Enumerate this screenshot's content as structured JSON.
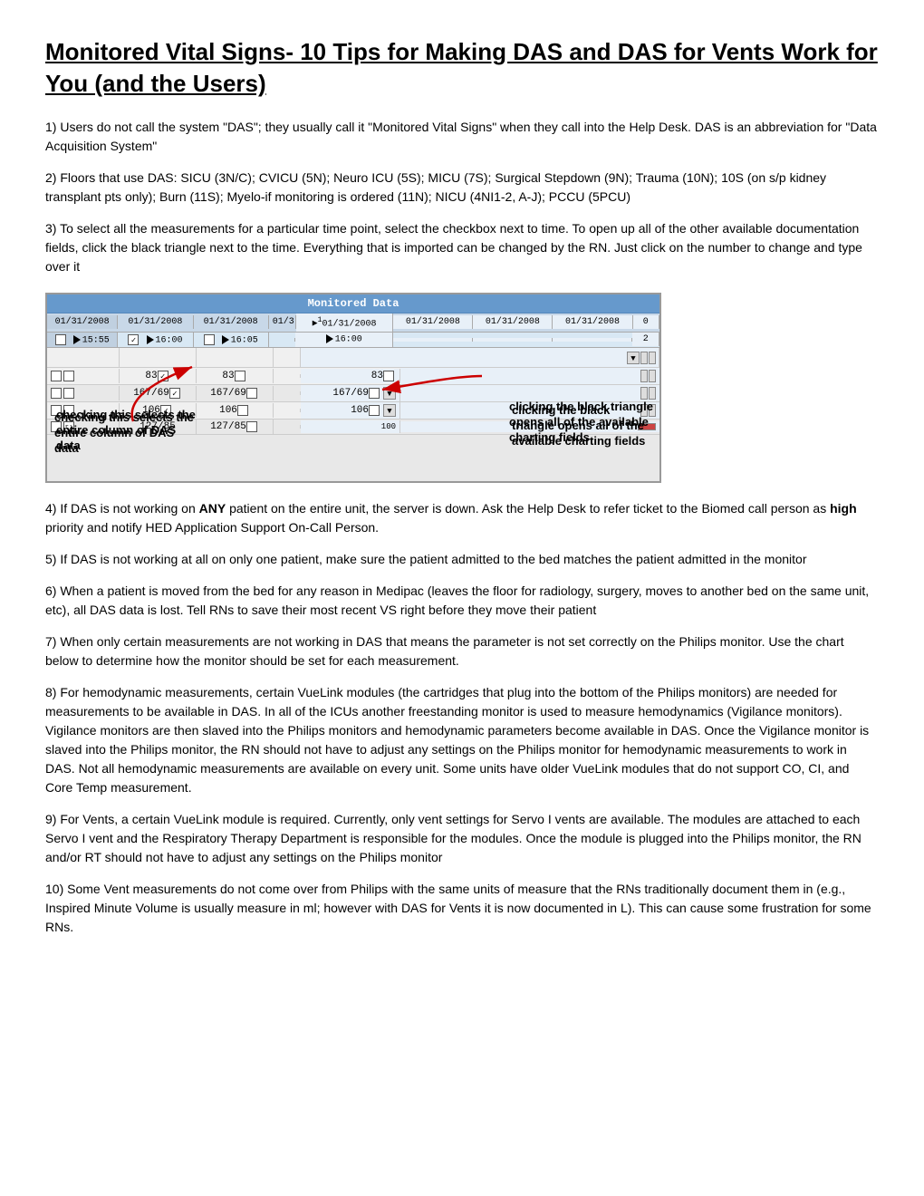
{
  "title": "Monitored Vital Signs- 10 Tips for Making DAS and DAS for Vents Work for You (and the Users)",
  "paragraphs": [
    {
      "id": "p1",
      "text": "1) Users do not call the system \"DAS\"; they usually call it \"Monitored Vital Signs\" when they call into the Help Desk. DAS is an abbreviation for \"Data Acquisition System\""
    },
    {
      "id": "p2",
      "text": "2) Floors that use DAS: SICU (3N/C); CVICU (5N); Neuro ICU (5S); MICU (7S); Surgical Stepdown (9N); Trauma (10N); 10S (on s/p kidney transplant pts only); Burn (11S); Myelo-if monitoring is ordered (11N); NICU (4NI1-2, A-J); PCCU (5PCU)"
    },
    {
      "id": "p3",
      "text": "3) To select all the measurements for a particular time point, select the checkbox next to time. To open up all of the other available documentation fields, click the black triangle next to the time. Everything that is imported can be changed by the RN. Just click on the number to change and type over it"
    },
    {
      "id": "p4",
      "html": true,
      "text": "4) If DAS is not working on <b>ANY</b> patient on the entire unit, the server is down. Ask the Help Desk to refer ticket to the Biomed call person as <b>high</b> priority and notify HED Application Support On-Call Person."
    },
    {
      "id": "p5",
      "text": "5) If DAS is not working at all on only one patient, make sure the patient admitted to the bed matches the patient admitted in the monitor"
    },
    {
      "id": "p6",
      "text": "6) When a patient is moved from the bed for any reason in Medipac (leaves the floor for radiology, surgery, moves to another bed on the same unit, etc), all DAS data is lost. Tell RNs to save their most recent VS right before they move their patient"
    },
    {
      "id": "p7",
      "text": "7) When only certain measurements are not working in DAS that means the parameter is not set correctly on the Philips monitor. Use the chart below to determine how the monitor should be set for each measurement."
    },
    {
      "id": "p8",
      "text": "8) For hemodynamic measurements, certain VueLink modules (the cartridges that plug into the bottom of the Philips monitors) are needed for measurements to be available in DAS. In all of the ICUs another freestanding monitor is used to measure hemodynamics (Vigilance monitors). Vigilance monitors are then slaved into the Philips monitors and hemodynamic parameters become available in DAS. Once the Vigilance monitor is slaved into the Philips monitor, the RN should not have to adjust any settings on the Philips monitor for hemodynamic measurements to work in DAS. Not all hemodynamic measurements are available on every unit. Some units have older VueLink modules that do not support CO, CI, and Core Temp measurement."
    },
    {
      "id": "p9",
      "text": "9) For Vents, a certain VueLink module is required. Currently, only vent settings for Servo I vents are available. The modules are attached to each Servo I vent and the Respiratory Therapy Department is responsible for the modules. Once the module is plugged into the Philips monitor, the RN and/or RT should not have to adjust any settings on the Philips monitor"
    },
    {
      "id": "p10",
      "text": "10) Some Vent measurements do not come over from Philips with the same units of measure that the RNs traditionally document them in (e.g., Inspired Minute Volume is usually measure in ml; however with DAS for Vents it is now documented in L). This can cause some frustration for some RNs."
    }
  ],
  "das_image": {
    "title": "Monitored Data",
    "dates": [
      "01/31/2008",
      "01/31/2008",
      "01/31/2008",
      "01/3",
      "01/31/2008",
      "01/31/2008",
      "01/31/2008",
      "01/31/2008",
      "0"
    ],
    "times": [
      "15:55",
      "16:00",
      "16:05",
      "",
      "16:00",
      "",
      "",
      "",
      ""
    ],
    "rows": [
      {
        "cells": [
          "83",
          "83",
          "83"
        ]
      },
      {
        "cells": [
          "167/69",
          "167/69",
          "167/69"
        ]
      },
      {
        "cells": [
          "106",
          "106",
          "106"
        ]
      },
      {
        "cells": [
          "127/85",
          "127/85",
          "127/85"
        ]
      }
    ],
    "annotation_left": "checking this selects the entire column of DAS data",
    "annotation_right": "clicking the black triangle opens all of the available charting fields"
  }
}
